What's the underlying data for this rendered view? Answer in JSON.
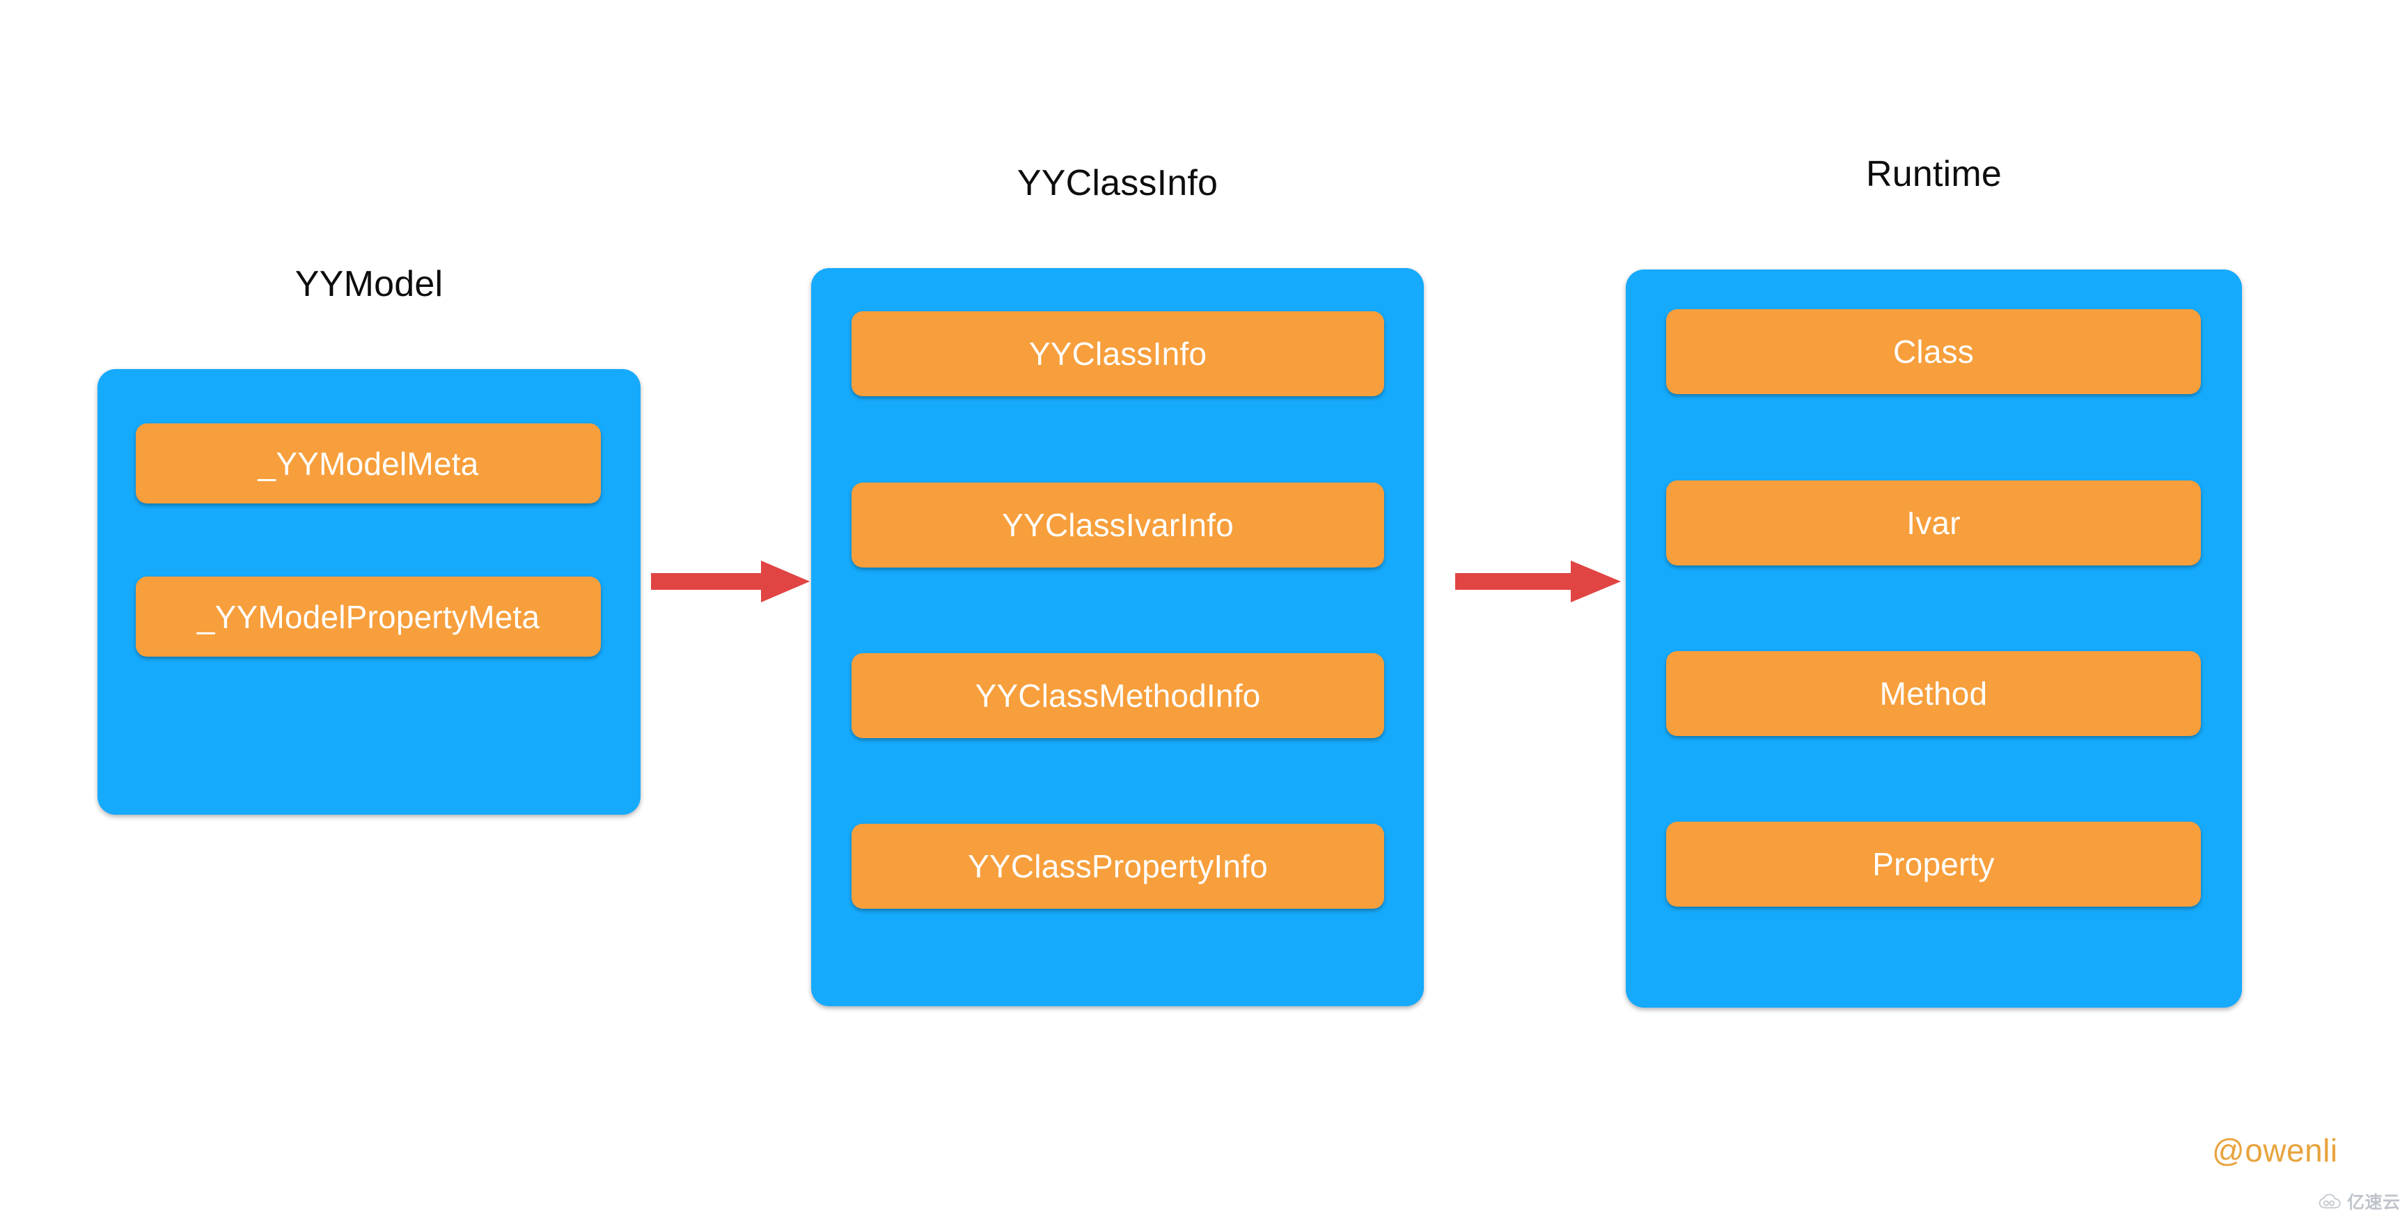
{
  "groups": [
    {
      "key": "yymodel",
      "title": "YYModel",
      "items": [
        {
          "label": "_YYModelMeta"
        },
        {
          "label": "_YYModelPropertyMeta"
        }
      ]
    },
    {
      "key": "yyclassinfo",
      "title": "YYClassInfo",
      "items": [
        {
          "label": "YYClassInfo"
        },
        {
          "label": "YYClassIvarInfo"
        },
        {
          "label": "YYClassMethodInfo"
        },
        {
          "label": "YYClassPropertyInfo"
        }
      ]
    },
    {
      "key": "runtime",
      "title": "Runtime",
      "items": [
        {
          "label": "Class"
        },
        {
          "label": "Ivar"
        },
        {
          "label": "Method"
        },
        {
          "label": "Property"
        }
      ]
    }
  ],
  "arrows": [
    {
      "key": "yymodel-to-yyclassinfo"
    },
    {
      "key": "yyclassinfo-to-runtime"
    }
  ],
  "watermarks": {
    "handle": "@owenli",
    "brand": "亿速云"
  },
  "colors": {
    "panel_blue": "#16aafc",
    "item_orange": "#f79f3c",
    "arrow_red": "#e04543",
    "title_black": "#0d0d0d",
    "item_text_white": "#ffffff",
    "handle_orange": "#e8a33d",
    "brand_gray": "#9aa3ad",
    "background": "#ffffff"
  }
}
